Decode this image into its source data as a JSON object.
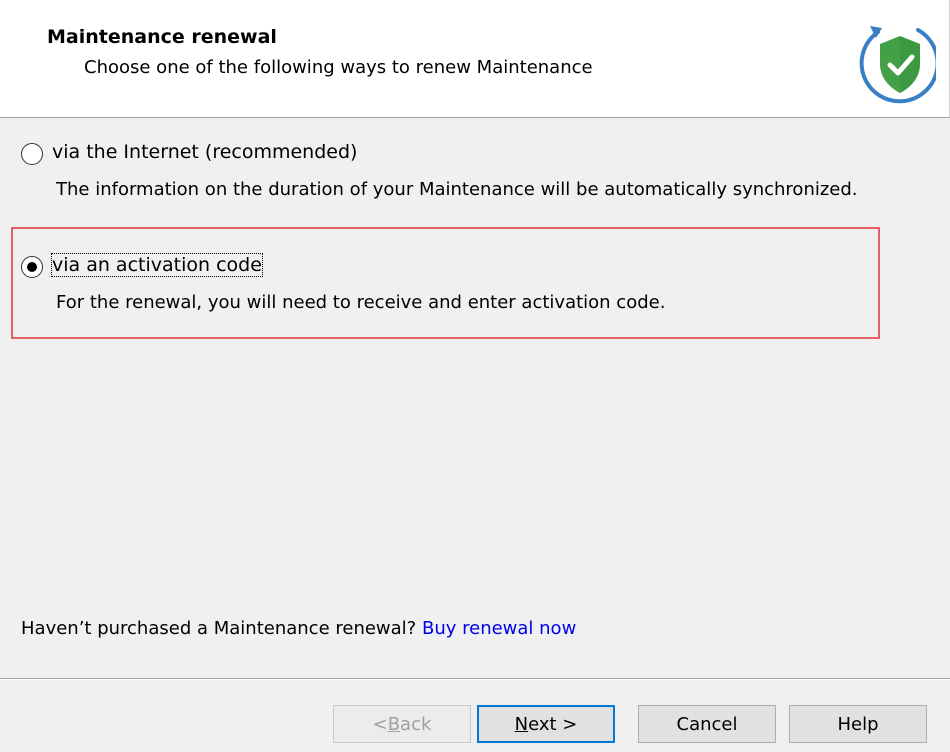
{
  "header": {
    "title": "Maintenance renewal",
    "subtitle": "Choose one of the following ways to renew Maintenance",
    "icon": "shield-check-icon",
    "colors": {
      "shield": "#43a047",
      "ring": "#3a7fc4"
    }
  },
  "options": [
    {
      "label": "via the Internet (recommended)",
      "description": "The information on the duration of your Maintenance will be automatically synchronized.",
      "checked": false
    },
    {
      "label": "via an activation code",
      "description": "For the renewal, you will need to receive and enter activation code.",
      "checked": true
    }
  ],
  "purchase": {
    "question": "Haven’t purchased a Maintenance renewal?",
    "link": "Buy renewal now"
  },
  "buttons": {
    "back": {
      "prefix": "< ",
      "accel": "B",
      "rest": "ack",
      "enabled": false
    },
    "next": {
      "accel": "N",
      "rest": "ext >",
      "enabled": true
    },
    "cancel": "Cancel",
    "help": "Help"
  },
  "colors": {
    "highlight_border": "#e8606a",
    "link": "#0000ee",
    "default_button_border": "#0078d7"
  }
}
